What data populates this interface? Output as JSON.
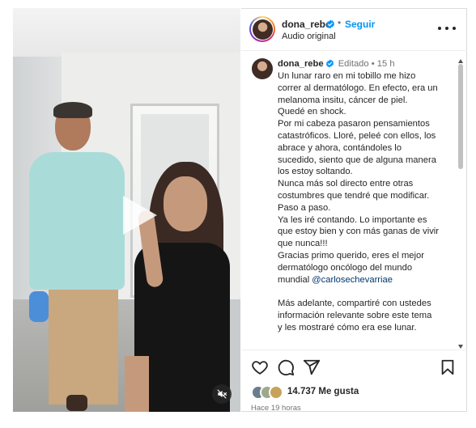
{
  "header": {
    "username": "dona_rebe",
    "separator": "•",
    "follow_label": "Seguir",
    "audio_label": "Audio original"
  },
  "caption": {
    "username": "dona_rebe",
    "edited_label": "Editado",
    "separator": "•",
    "time": "15 h",
    "lines": [
      "Un lunar raro en mi tobillo me hizo",
      "correr al dermatólogo. En efecto, era un",
      "melanoma insitu, cáncer de piel.",
      "Quedé en shock.",
      "Por mi cabeza pasaron pensamientos",
      "catastróficos. Lloré, peleé con ellos, los",
      "abrace y ahora, contándoles lo",
      "sucedido, siento que de alguna manera",
      "los estoy soltando.",
      "Nunca más sol directo entre otras",
      "costumbres que tendré que modificar.",
      "Paso a paso.",
      "Ya les iré contando. Lo importante es",
      "que estoy bien y con más ganas de vivir",
      "que nunca!!!",
      "Gracias primo querido, eres el mejor",
      "dermatólogo oncólogo del mundo"
    ],
    "mention_line_prefix": "mundial ",
    "mention": "@carlosechevarriae",
    "after_lines": [
      "Más adelante, compartiré con ustedes",
      "información relevante sobre este tema",
      "y les mostraré cómo era ese lunar."
    ]
  },
  "engagement": {
    "likes_count": "14.737",
    "likes_label": "Me gusta",
    "posted_ago": "Hace 19 horas"
  },
  "icons": {
    "verified": "verified-badge-icon",
    "more": "more-options-icon",
    "like": "heart-icon",
    "comment": "comment-icon",
    "share": "share-icon",
    "save": "bookmark-icon",
    "play": "play-icon",
    "mute": "muted-speaker-icon"
  },
  "colors": {
    "accent": "#0095f6",
    "verified": "#0095f6",
    "mention": "#00376b",
    "muted_text": "#737373"
  }
}
